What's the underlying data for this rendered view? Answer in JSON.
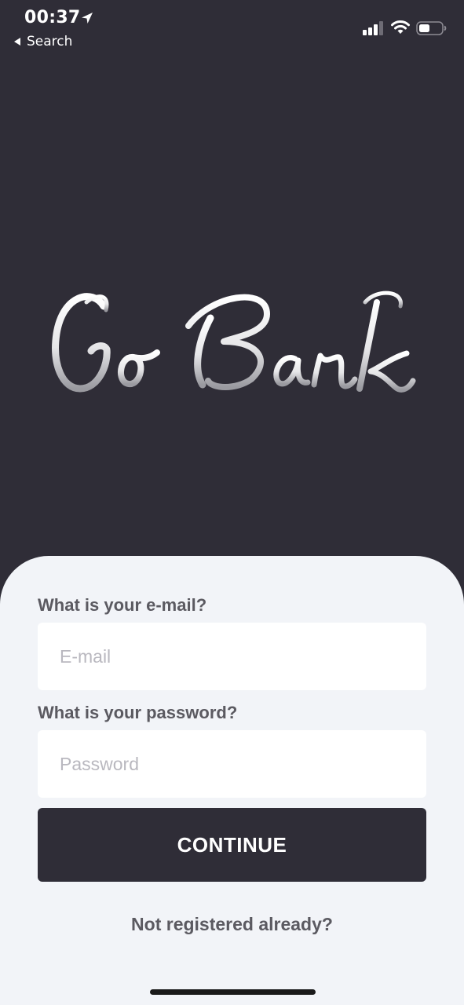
{
  "status_bar": {
    "time": "00:37",
    "back_label": "Search",
    "icons": [
      "location-arrow-icon",
      "back-arrow-icon",
      "cellular-signal-icon",
      "wifi-icon",
      "battery-icon"
    ]
  },
  "logo": {
    "text": "Go Bank"
  },
  "form": {
    "email_question": "What is your e-mail?",
    "email_placeholder": "E-mail",
    "email_value": "",
    "password_question": "What is your password?",
    "password_placeholder": "Password",
    "password_value": "",
    "continue_label": "CONTINUE",
    "register_link": "Not registered already?"
  },
  "colors": {
    "background": "#2f2d37",
    "card": "#f2f4f8",
    "label_text": "#5b5a61",
    "placeholder": "#b9b8bf",
    "button": "#2f2d37"
  }
}
